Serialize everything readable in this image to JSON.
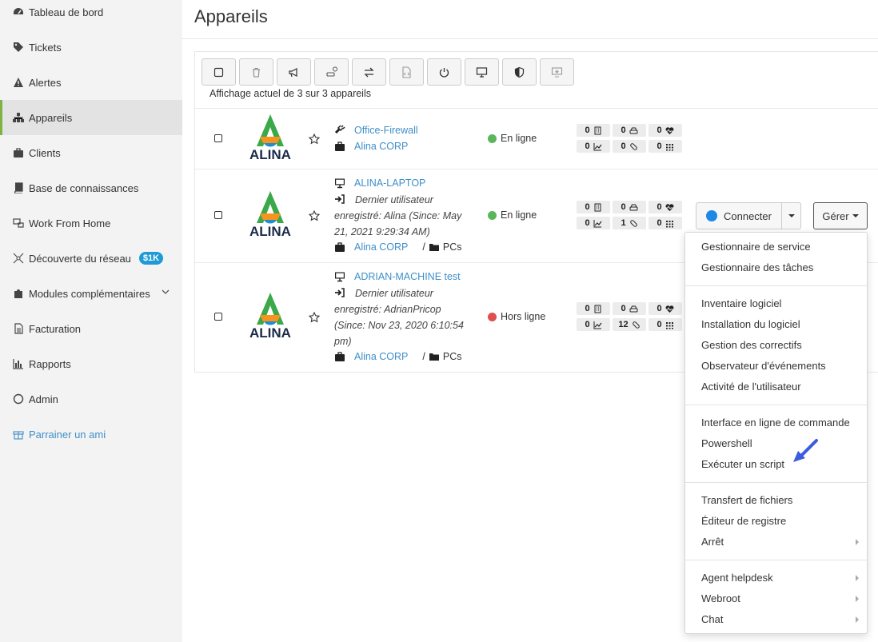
{
  "sidebar": {
    "items": [
      {
        "label": "Tableau de bord",
        "icon": "dashboard-icon"
      },
      {
        "label": "Tickets",
        "icon": "tag-icon"
      },
      {
        "label": "Alertes",
        "icon": "warning-icon"
      },
      {
        "label": "Appareils",
        "icon": "sitemap-icon",
        "active": true
      },
      {
        "label": "Clients",
        "icon": "briefcase-icon"
      },
      {
        "label": "Base de connaissances",
        "icon": "book-icon"
      },
      {
        "label": "Work From Home",
        "icon": "remote-icon"
      },
      {
        "label": "Découverte du réseau",
        "icon": "network-icon",
        "badge": "$1K"
      },
      {
        "label": "Modules complémentaires",
        "icon": "puzzle-icon"
      },
      {
        "label": "Facturation",
        "icon": "document-icon"
      },
      {
        "label": "Rapports",
        "icon": "bar-chart-icon"
      },
      {
        "label": "Admin",
        "icon": "power-ring-icon"
      },
      {
        "label": "Parrainer un ami",
        "icon": "gift-icon"
      }
    ]
  },
  "page": {
    "title": "Appareils",
    "showing": "Affichage actuel de 3 sur 3 appareils"
  },
  "toolbar": [
    "select-all",
    "delete",
    "announce",
    "schedule-drive",
    "transfer",
    "script-file",
    "power",
    "remote-screen",
    "shield",
    "remote-download"
  ],
  "devices": [
    {
      "name": "Office-Firewall",
      "client": "Alina CORP",
      "logo_text": "ALINA",
      "status": "En ligne",
      "status_color": "#5bb55b",
      "stats": [
        "0",
        "0",
        "0",
        "0",
        "0",
        "0"
      ]
    },
    {
      "name": "ALINA-LAPTOP",
      "last_user": "Dernier utilisateur enregistré: Alina (Since: May 21, 2021 9:29:34 AM)",
      "client": "Alina CORP",
      "folder": "PCs",
      "logo_text": "ALINA",
      "status": "En ligne",
      "status_color": "#5bb55b",
      "stats": [
        "0",
        "0",
        "0",
        "0",
        "1",
        "0"
      ]
    },
    {
      "name": "ADRIAN-MACHINE test",
      "last_user": "Dernier utilisateur enregistré: AdrianPricop (Since: Nov 23, 2020 6:10:54 pm)",
      "client": "Alina CORP",
      "folder": "PCs",
      "logo_text": "ALINA",
      "status": "Hors ligne",
      "status_color": "#e04e4e",
      "stats": [
        "0",
        "0",
        "0",
        "0",
        "12",
        "0"
      ]
    }
  ],
  "actions": {
    "connect": "Connecter",
    "manage": "Gérer"
  },
  "menu": {
    "groups": [
      [
        "Gestionnaire de service",
        "Gestionnaire des tâches"
      ],
      [
        "Inventaire logiciel",
        "Installation du logiciel",
        "Gestion des correctifs",
        "Observateur d'événements",
        "Activité de l'utilisateur"
      ],
      [
        "Interface en ligne de commande",
        "Powershell",
        "Exécuter un script"
      ],
      [
        "Transfert de fichiers",
        "Éditeur de registre",
        "Arrêt"
      ],
      [
        "Agent helpdesk",
        "Webroot",
        "Chat"
      ]
    ],
    "submenu_items": [
      "Arrêt",
      "Agent helpdesk",
      "Webroot",
      "Chat"
    ]
  },
  "colors": {
    "link": "#3f8fc9",
    "active_border": "#7cb342",
    "online": "#5bb55b",
    "offline": "#e04e4e",
    "badge": "#1e9ad6",
    "pointer_arrow": "#3c5ce0"
  }
}
